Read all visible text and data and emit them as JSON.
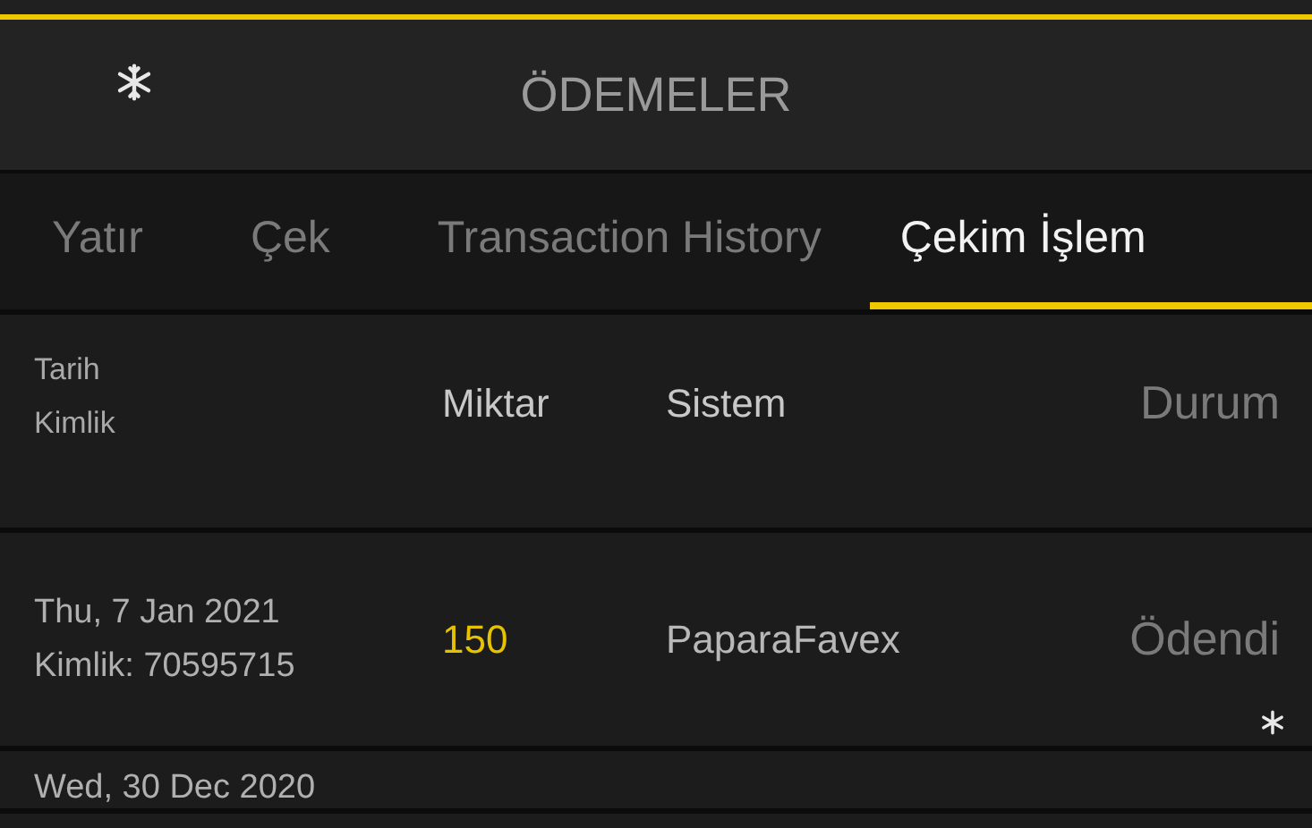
{
  "header": {
    "title": "ÖDEMELER"
  },
  "tabs": [
    {
      "label": "Yatır",
      "selected": false
    },
    {
      "label": "Çek",
      "selected": false
    },
    {
      "label": "Transaction History",
      "selected": false
    },
    {
      "label": "Çekim İşlem",
      "selected": true
    }
  ],
  "table": {
    "columns": [
      {
        "label": "Tarih",
        "sublabel": "Kimlik"
      },
      {
        "label": "Miktar"
      },
      {
        "label": "Sistem"
      },
      {
        "label": "Durum"
      }
    ],
    "rows": [
      {
        "date": "Thu, 7 Jan 2021",
        "id": "Kimlik: 70595715",
        "amount": "150",
        "system": "PaparaFavex",
        "status": "Ödendi"
      },
      {
        "date": "Wed, 30 Dec 2020"
      }
    ]
  }
}
